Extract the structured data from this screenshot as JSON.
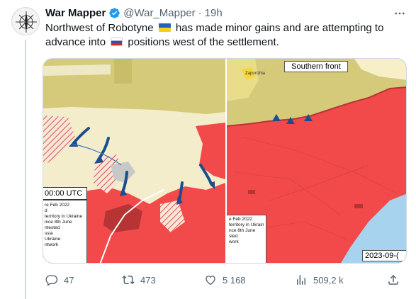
{
  "tweet": {
    "author_name": "War Mapper",
    "handle": "@War_Mapper",
    "separator": "·",
    "time": "19h",
    "text_part1": "Northwest of Robotyne",
    "text_part2": "has made minor gains and are attempting to advance into",
    "text_part3": "positions west of the settlement."
  },
  "media": {
    "left_map": {
      "time_label": "00:00 UTC",
      "legend_lines": [
        "re Feb 2022",
        "d",
        "territory in Ukraine",
        "",
        "ince 8th June",
        "ntested",
        "ssia",
        "Ukraine",
        "",
        "ntwork"
      ]
    },
    "right_map": {
      "title": "Southern front",
      "date": "2023-09-(",
      "legend_lines": [
        "e Feb 2022",
        "",
        "territory in Ukraine",
        "",
        "nce 8th June",
        "sted",
        "",
        "work"
      ],
      "city_label": "Zaporizhia"
    }
  },
  "actions": {
    "replies": "47",
    "retweets": "473",
    "likes": "5 168",
    "views": "509,2 k"
  },
  "colors": {
    "occupied": "#f24a4a",
    "contested": "#f6efc8",
    "ukraine_base": "#f3edcc",
    "advance_arrow": "#1b4e8c",
    "water": "#a8d3ef"
  },
  "icons": [
    "verified-badge-icon",
    "more-icon",
    "reply-icon",
    "retweet-icon",
    "like-icon",
    "views-icon",
    "share-icon"
  ]
}
